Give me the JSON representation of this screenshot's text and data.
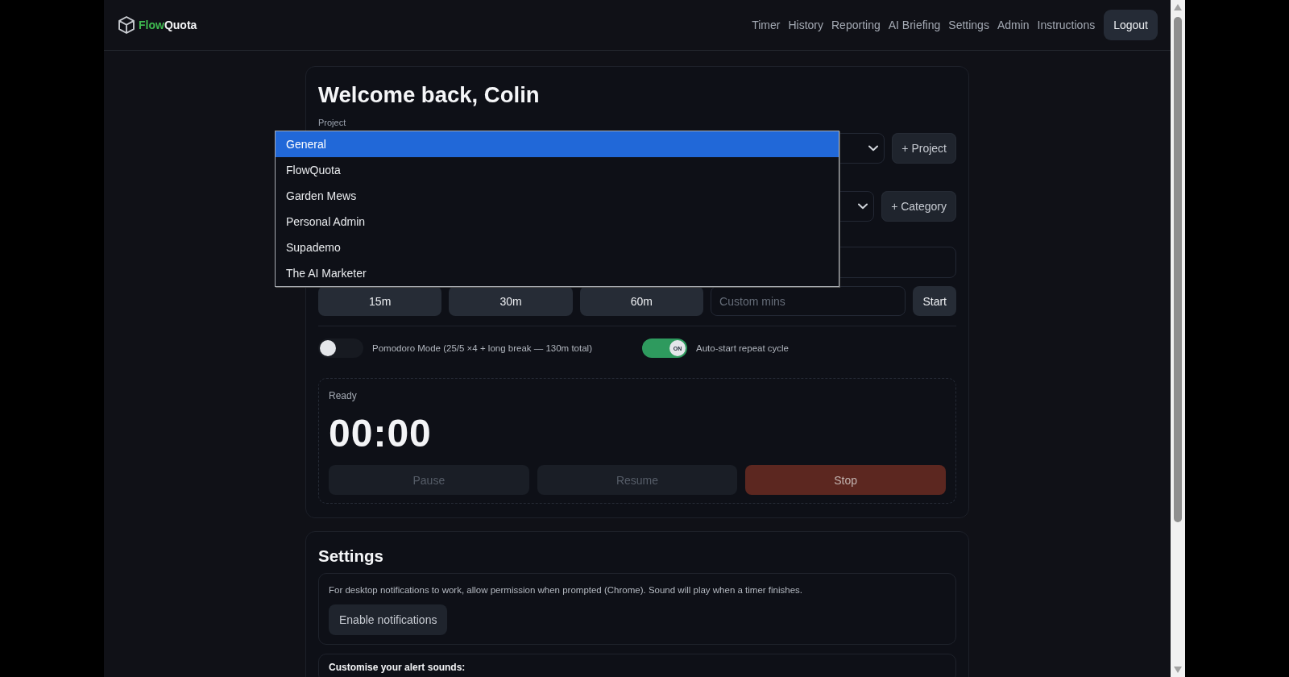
{
  "header": {
    "brand": {
      "part_1": "Flow",
      "part_2": "Quota"
    },
    "nav": [
      {
        "label": "Timer"
      },
      {
        "label": "History"
      },
      {
        "label": "Reporting"
      },
      {
        "label": "AI Briefing"
      },
      {
        "label": "Settings"
      },
      {
        "label": "Admin"
      },
      {
        "label": "Instructions"
      }
    ],
    "logout": "Logout"
  },
  "timer_card": {
    "title": "Welcome back, Colin",
    "project_label": "Project",
    "add_project": "+ Project",
    "add_category": "+ Category",
    "presets": [
      "15m",
      "30m",
      "60m"
    ],
    "custom_minutes": {
      "placeholder": "Custom mins"
    },
    "start": "Start",
    "toggles": [
      {
        "label": "Pomodoro Mode (25/5 ×4 + long break — 130m total)",
        "on": false
      },
      {
        "label": "Auto-start repeat cycle",
        "on": true,
        "knob_label": "ON"
      }
    ],
    "timer": {
      "status": "Ready",
      "display": "00:00",
      "buttons": [
        {
          "label": "Pause",
          "kind": "neutral",
          "disabled": true
        },
        {
          "label": "Resume",
          "kind": "neutral",
          "disabled": true
        },
        {
          "label": "Stop",
          "kind": "danger",
          "disabled": false
        }
      ]
    }
  },
  "project_dropdown": {
    "options": [
      {
        "label": "General",
        "selected": true
      },
      {
        "label": "FlowQuota",
        "selected": false
      },
      {
        "label": "Garden Mews",
        "selected": false
      },
      {
        "label": "Personal Admin",
        "selected": false
      },
      {
        "label": "Supademo",
        "selected": false
      },
      {
        "label": "The AI Marketer",
        "selected": false
      }
    ]
  },
  "settings": {
    "title": "Settings",
    "notice": "For desktop notifications to work, allow permission when prompted (Chrome). Sound will play when a timer finishes.",
    "enable_button": "Enable notifications",
    "sounds_heading": "Customise your alert sounds:"
  }
}
